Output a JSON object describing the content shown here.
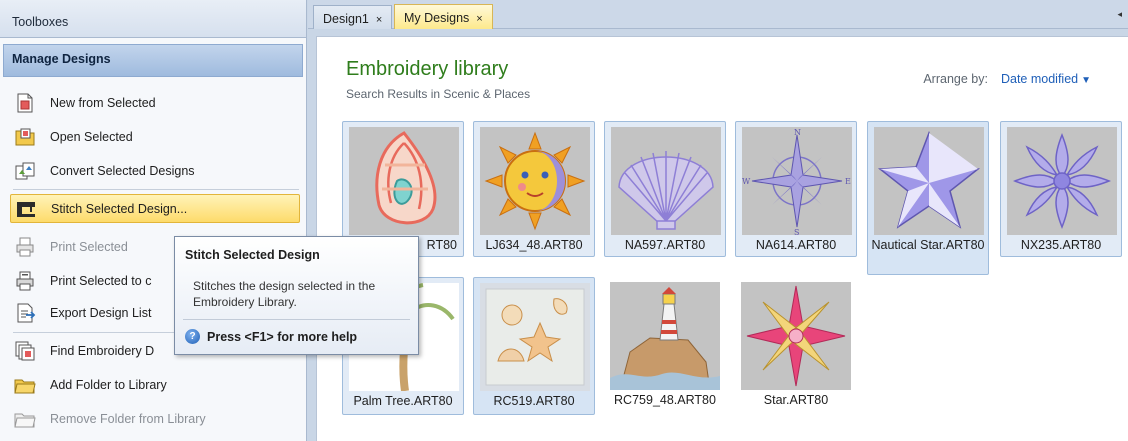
{
  "toolbox": {
    "header": "Toolboxes",
    "section_title": "Manage Designs",
    "commands": [
      {
        "label": "New from Selected",
        "icon": "new-from-selected-icon",
        "enabled": true
      },
      {
        "label": "Open Selected",
        "icon": "open-selected-icon",
        "enabled": true
      },
      {
        "label": "Convert Selected Designs",
        "icon": "convert-designs-icon",
        "enabled": true
      },
      {
        "label": "Stitch Selected Design...",
        "icon": "stitch-machine-icon",
        "enabled": true,
        "highlighted": true
      },
      {
        "label": "Print Selected",
        "icon": "print-icon",
        "enabled": false
      },
      {
        "label": "Print Selected to c",
        "icon": "print-to-file-icon",
        "enabled": true
      },
      {
        "label": "Export Design List",
        "icon": "export-list-icon",
        "enabled": true
      },
      {
        "label": "Find Embroidery D",
        "icon": "find-designs-icon",
        "enabled": true
      },
      {
        "label": "Add Folder to Library",
        "icon": "add-folder-icon",
        "enabled": true
      },
      {
        "label": "Remove Folder from Library",
        "icon": "remove-folder-icon",
        "enabled": false
      }
    ]
  },
  "tabs": [
    {
      "label": "Design1",
      "close": "×",
      "active": false
    },
    {
      "label": "My Designs",
      "close": "×",
      "active": true
    }
  ],
  "tab_menu_glyph": "◂",
  "library": {
    "title": "Embroidery library",
    "subtitle": "Search Results in Scenic & Places",
    "arrange_label": "Arrange by:",
    "arrange_value": "Date modified",
    "arrange_caret": "▼",
    "designs": [
      {
        "name": "RT80",
        "thumb": "seashell-spiral"
      },
      {
        "name": "LJ634_48.ART80",
        "thumb": "sun-moon"
      },
      {
        "name": "NA597.ART80",
        "thumb": "scallop-shell"
      },
      {
        "name": "NA614.ART80",
        "thumb": "compass-rose"
      },
      {
        "name": "Nautical Star.ART80",
        "thumb": "nautical-star"
      },
      {
        "name": "NX235.ART80",
        "thumb": "lace-flower"
      },
      {
        "name": "Palm Tree.ART80",
        "thumb": "palm-tree"
      },
      {
        "name": "RC519.ART80",
        "thumb": "sea-collage"
      },
      {
        "name": "RC759_48.ART80",
        "thumb": "lighthouse"
      },
      {
        "name": "Star.ART80",
        "thumb": "star-compass"
      }
    ]
  },
  "tooltip": {
    "title": "Stitch Selected Design",
    "body": "Stitches the design selected in the Embroidery Library.",
    "help_text": "Press <F1> for more help",
    "help_icon": "?"
  },
  "colors": {
    "accent_title": "#2f7d1c",
    "link_blue": "#1f5fb8",
    "hover_gold": "#fddb6b",
    "selection_blue": "#d6e4f4"
  }
}
